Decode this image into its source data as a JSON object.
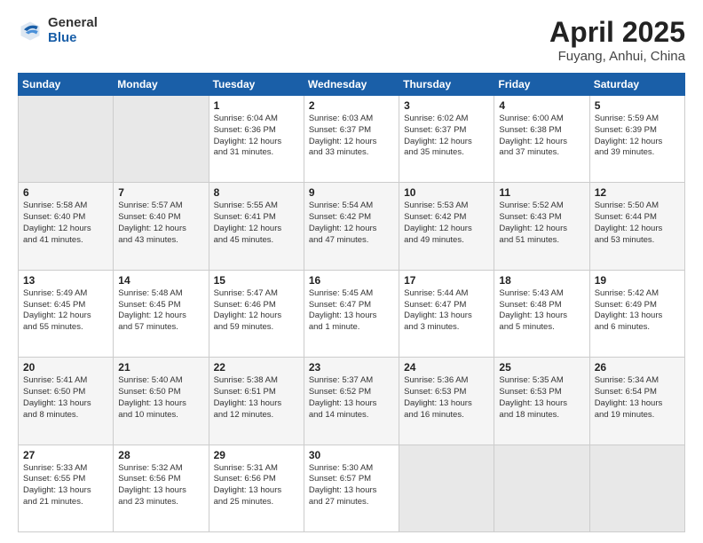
{
  "logo": {
    "general": "General",
    "blue": "Blue"
  },
  "title": {
    "month": "April 2025",
    "location": "Fuyang, Anhui, China"
  },
  "headers": [
    "Sunday",
    "Monday",
    "Tuesday",
    "Wednesday",
    "Thursday",
    "Friday",
    "Saturday"
  ],
  "weeks": [
    [
      {
        "num": "",
        "info": ""
      },
      {
        "num": "",
        "info": ""
      },
      {
        "num": "1",
        "info": "Sunrise: 6:04 AM\nSunset: 6:36 PM\nDaylight: 12 hours\nand 31 minutes."
      },
      {
        "num": "2",
        "info": "Sunrise: 6:03 AM\nSunset: 6:37 PM\nDaylight: 12 hours\nand 33 minutes."
      },
      {
        "num": "3",
        "info": "Sunrise: 6:02 AM\nSunset: 6:37 PM\nDaylight: 12 hours\nand 35 minutes."
      },
      {
        "num": "4",
        "info": "Sunrise: 6:00 AM\nSunset: 6:38 PM\nDaylight: 12 hours\nand 37 minutes."
      },
      {
        "num": "5",
        "info": "Sunrise: 5:59 AM\nSunset: 6:39 PM\nDaylight: 12 hours\nand 39 minutes."
      }
    ],
    [
      {
        "num": "6",
        "info": "Sunrise: 5:58 AM\nSunset: 6:40 PM\nDaylight: 12 hours\nand 41 minutes."
      },
      {
        "num": "7",
        "info": "Sunrise: 5:57 AM\nSunset: 6:40 PM\nDaylight: 12 hours\nand 43 minutes."
      },
      {
        "num": "8",
        "info": "Sunrise: 5:55 AM\nSunset: 6:41 PM\nDaylight: 12 hours\nand 45 minutes."
      },
      {
        "num": "9",
        "info": "Sunrise: 5:54 AM\nSunset: 6:42 PM\nDaylight: 12 hours\nand 47 minutes."
      },
      {
        "num": "10",
        "info": "Sunrise: 5:53 AM\nSunset: 6:42 PM\nDaylight: 12 hours\nand 49 minutes."
      },
      {
        "num": "11",
        "info": "Sunrise: 5:52 AM\nSunset: 6:43 PM\nDaylight: 12 hours\nand 51 minutes."
      },
      {
        "num": "12",
        "info": "Sunrise: 5:50 AM\nSunset: 6:44 PM\nDaylight: 12 hours\nand 53 minutes."
      }
    ],
    [
      {
        "num": "13",
        "info": "Sunrise: 5:49 AM\nSunset: 6:45 PM\nDaylight: 12 hours\nand 55 minutes."
      },
      {
        "num": "14",
        "info": "Sunrise: 5:48 AM\nSunset: 6:45 PM\nDaylight: 12 hours\nand 57 minutes."
      },
      {
        "num": "15",
        "info": "Sunrise: 5:47 AM\nSunset: 6:46 PM\nDaylight: 12 hours\nand 59 minutes."
      },
      {
        "num": "16",
        "info": "Sunrise: 5:45 AM\nSunset: 6:47 PM\nDaylight: 13 hours\nand 1 minute."
      },
      {
        "num": "17",
        "info": "Sunrise: 5:44 AM\nSunset: 6:47 PM\nDaylight: 13 hours\nand 3 minutes."
      },
      {
        "num": "18",
        "info": "Sunrise: 5:43 AM\nSunset: 6:48 PM\nDaylight: 13 hours\nand 5 minutes."
      },
      {
        "num": "19",
        "info": "Sunrise: 5:42 AM\nSunset: 6:49 PM\nDaylight: 13 hours\nand 6 minutes."
      }
    ],
    [
      {
        "num": "20",
        "info": "Sunrise: 5:41 AM\nSunset: 6:50 PM\nDaylight: 13 hours\nand 8 minutes."
      },
      {
        "num": "21",
        "info": "Sunrise: 5:40 AM\nSunset: 6:50 PM\nDaylight: 13 hours\nand 10 minutes."
      },
      {
        "num": "22",
        "info": "Sunrise: 5:38 AM\nSunset: 6:51 PM\nDaylight: 13 hours\nand 12 minutes."
      },
      {
        "num": "23",
        "info": "Sunrise: 5:37 AM\nSunset: 6:52 PM\nDaylight: 13 hours\nand 14 minutes."
      },
      {
        "num": "24",
        "info": "Sunrise: 5:36 AM\nSunset: 6:53 PM\nDaylight: 13 hours\nand 16 minutes."
      },
      {
        "num": "25",
        "info": "Sunrise: 5:35 AM\nSunset: 6:53 PM\nDaylight: 13 hours\nand 18 minutes."
      },
      {
        "num": "26",
        "info": "Sunrise: 5:34 AM\nSunset: 6:54 PM\nDaylight: 13 hours\nand 19 minutes."
      }
    ],
    [
      {
        "num": "27",
        "info": "Sunrise: 5:33 AM\nSunset: 6:55 PM\nDaylight: 13 hours\nand 21 minutes."
      },
      {
        "num": "28",
        "info": "Sunrise: 5:32 AM\nSunset: 6:56 PM\nDaylight: 13 hours\nand 23 minutes."
      },
      {
        "num": "29",
        "info": "Sunrise: 5:31 AM\nSunset: 6:56 PM\nDaylight: 13 hours\nand 25 minutes."
      },
      {
        "num": "30",
        "info": "Sunrise: 5:30 AM\nSunset: 6:57 PM\nDaylight: 13 hours\nand 27 minutes."
      },
      {
        "num": "",
        "info": ""
      },
      {
        "num": "",
        "info": ""
      },
      {
        "num": "",
        "info": ""
      }
    ]
  ]
}
